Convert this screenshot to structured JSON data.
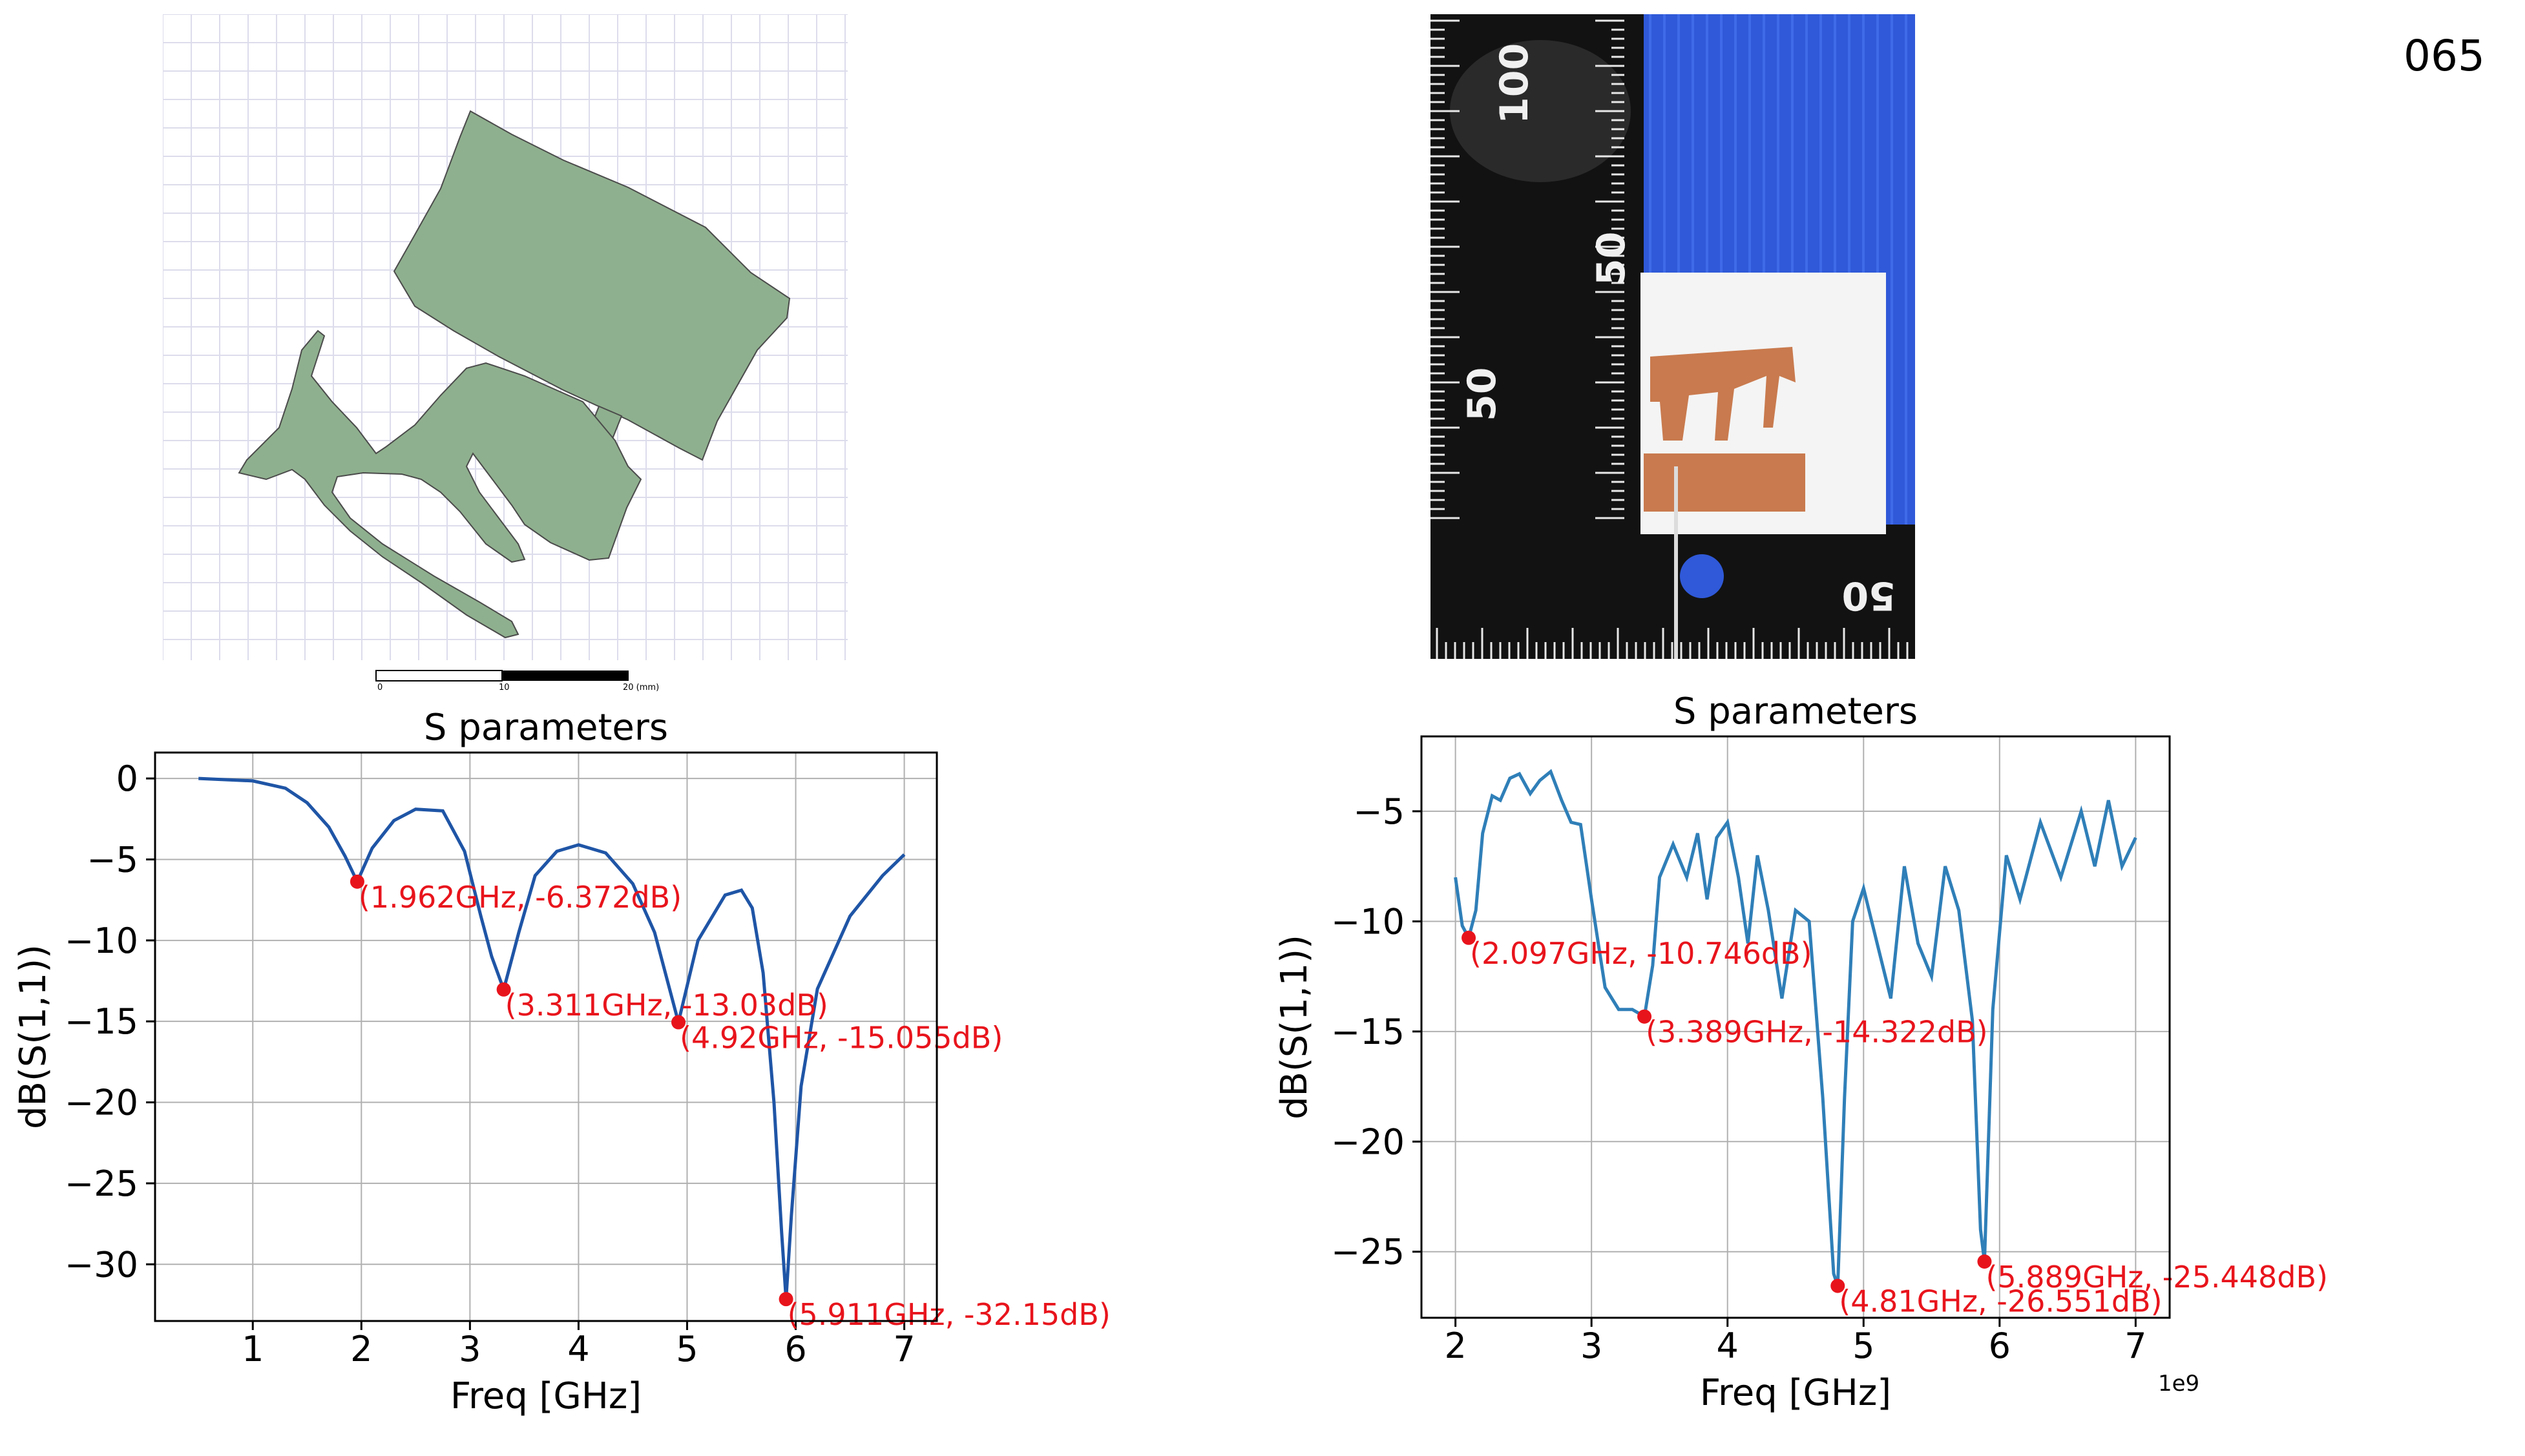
{
  "page_number": "065",
  "layout_scale_bar": {
    "ticks": [
      "0",
      "10",
      "20 (mm)"
    ]
  },
  "photo": {
    "ruler_big_labels": [
      "100",
      "50",
      "50",
      "50"
    ]
  },
  "colors": {
    "sim_line": "#1f55a6",
    "meas_line": "#2f7fb8",
    "marker": "#e8141c",
    "annotation": "#e8141c",
    "antenna_fill": "#8fb08e",
    "copper": "#c97a4e",
    "blue_board": "#2f59d8"
  },
  "chart_data": [
    {
      "type": "line",
      "title": "S parameters",
      "xlabel": "Freq [GHz]",
      "ylabel": "dB(S(1,1))",
      "xlim": [
        0.1,
        7.3
      ],
      "ylim": [
        -33.5,
        1.6
      ],
      "x_ticks": [
        1,
        2,
        3,
        4,
        5,
        6,
        7
      ],
      "x_tick_labels": [
        "1",
        "2",
        "3",
        "4",
        "5",
        "6",
        "7"
      ],
      "y_ticks": [
        0,
        -5,
        -10,
        -15,
        -20,
        -25,
        -30
      ],
      "y_tick_labels": [
        "0",
        "−5",
        "−10",
        "−15",
        "−20",
        "−25",
        "−30"
      ],
      "grid": true,
      "series": [
        {
          "x": [
            0.5,
            1.0,
            1.3,
            1.5,
            1.7,
            1.85,
            1.962,
            2.1,
            2.3,
            2.5,
            2.75,
            2.95,
            3.1,
            3.2,
            3.311,
            3.45,
            3.6,
            3.8,
            4.0,
            4.25,
            4.5,
            4.7,
            4.92,
            5.1,
            5.35,
            5.5,
            5.6,
            5.7,
            5.8,
            5.87,
            5.911,
            5.96,
            6.05,
            6.2,
            6.5,
            6.8,
            7.0
          ],
          "y": [
            0,
            -0.15,
            -0.6,
            -1.5,
            -3.0,
            -4.8,
            -6.372,
            -4.3,
            -2.6,
            -1.9,
            -2.0,
            -4.5,
            -8.5,
            -11.0,
            -13.03,
            -9.5,
            -6.0,
            -4.5,
            -4.1,
            -4.6,
            -6.5,
            -9.5,
            -15.055,
            -10.0,
            -7.2,
            -6.9,
            -8.0,
            -12.0,
            -20.0,
            -28.0,
            -32.15,
            -27.0,
            -19.0,
            -13.0,
            -8.5,
            -6.0,
            -4.7
          ]
        }
      ],
      "markers": [
        {
          "x": 1.962,
          "y": -6.372,
          "label": "(1.962GHz, -6.372dB)"
        },
        {
          "x": 3.311,
          "y": -13.03,
          "label": "(3.311GHz, -13.03dB)"
        },
        {
          "x": 4.92,
          "y": -15.055,
          "label": "(4.92GHz, -15.055dB)"
        },
        {
          "x": 5.911,
          "y": -32.15,
          "label": "(5.911GHz, -32.15dB)"
        }
      ]
    },
    {
      "type": "line",
      "title": "S parameters",
      "xlabel": "Freq [GHz]",
      "ylabel": "dB(S(1,1))",
      "offset_label": "1e9",
      "xlim": [
        1.75,
        7.25
      ],
      "ylim": [
        -28.0,
        -1.6
      ],
      "x_ticks": [
        2,
        3,
        4,
        5,
        6,
        7
      ],
      "x_tick_labels": [
        "2",
        "3",
        "4",
        "5",
        "6",
        "7"
      ],
      "y_ticks": [
        -5,
        -10,
        -15,
        -20,
        -25
      ],
      "y_tick_labels": [
        "−5",
        "−10",
        "−15",
        "−20",
        "−25"
      ],
      "grid": true,
      "series": [
        {
          "x": [
            2.0,
            2.05,
            2.097,
            2.15,
            2.2,
            2.27,
            2.33,
            2.4,
            2.47,
            2.55,
            2.62,
            2.7,
            2.78,
            2.85,
            2.92,
            3.0,
            3.1,
            3.2,
            3.3,
            3.389,
            3.45,
            3.5,
            3.6,
            3.7,
            3.78,
            3.85,
            3.92,
            4.0,
            4.08,
            4.15,
            4.22,
            4.3,
            4.4,
            4.5,
            4.6,
            4.7,
            4.78,
            4.81,
            4.86,
            4.92,
            5.0,
            5.1,
            5.2,
            5.3,
            5.4,
            5.5,
            5.6,
            5.7,
            5.8,
            5.86,
            5.889,
            5.95,
            6.05,
            6.15,
            6.3,
            6.45,
            6.6,
            6.7,
            6.8,
            6.9,
            7.0
          ],
          "y": [
            -8.0,
            -10.2,
            -10.746,
            -9.5,
            -6.0,
            -4.3,
            -4.5,
            -3.5,
            -3.3,
            -4.2,
            -3.6,
            -3.2,
            -4.5,
            -5.5,
            -5.6,
            -9.0,
            -13.0,
            -14.0,
            -14.0,
            -14.322,
            -12.0,
            -8.0,
            -6.5,
            -8.0,
            -6.0,
            -9.0,
            -6.2,
            -5.5,
            -8.0,
            -11.0,
            -7.0,
            -9.5,
            -13.5,
            -9.5,
            -10.0,
            -18.0,
            -26.0,
            -26.551,
            -18.0,
            -10.0,
            -8.5,
            -11.0,
            -13.5,
            -7.5,
            -11.0,
            -12.5,
            -7.5,
            -9.5,
            -14.5,
            -24.0,
            -25.448,
            -14.0,
            -7.0,
            -9.0,
            -5.5,
            -8.0,
            -5.0,
            -7.5,
            -4.5,
            -7.5,
            -6.2
          ]
        }
      ],
      "markers": [
        {
          "x": 2.097,
          "y": -10.746,
          "label": "(2.097GHz, -10.746dB)"
        },
        {
          "x": 3.389,
          "y": -14.322,
          "label": "(3.389GHz, -14.322dB)"
        },
        {
          "x": 4.81,
          "y": -26.551,
          "label": "(4.81GHz, -26.551dB)"
        },
        {
          "x": 5.889,
          "y": -25.448,
          "label": "(5.889GHz, -25.448dB)"
        }
      ]
    }
  ]
}
